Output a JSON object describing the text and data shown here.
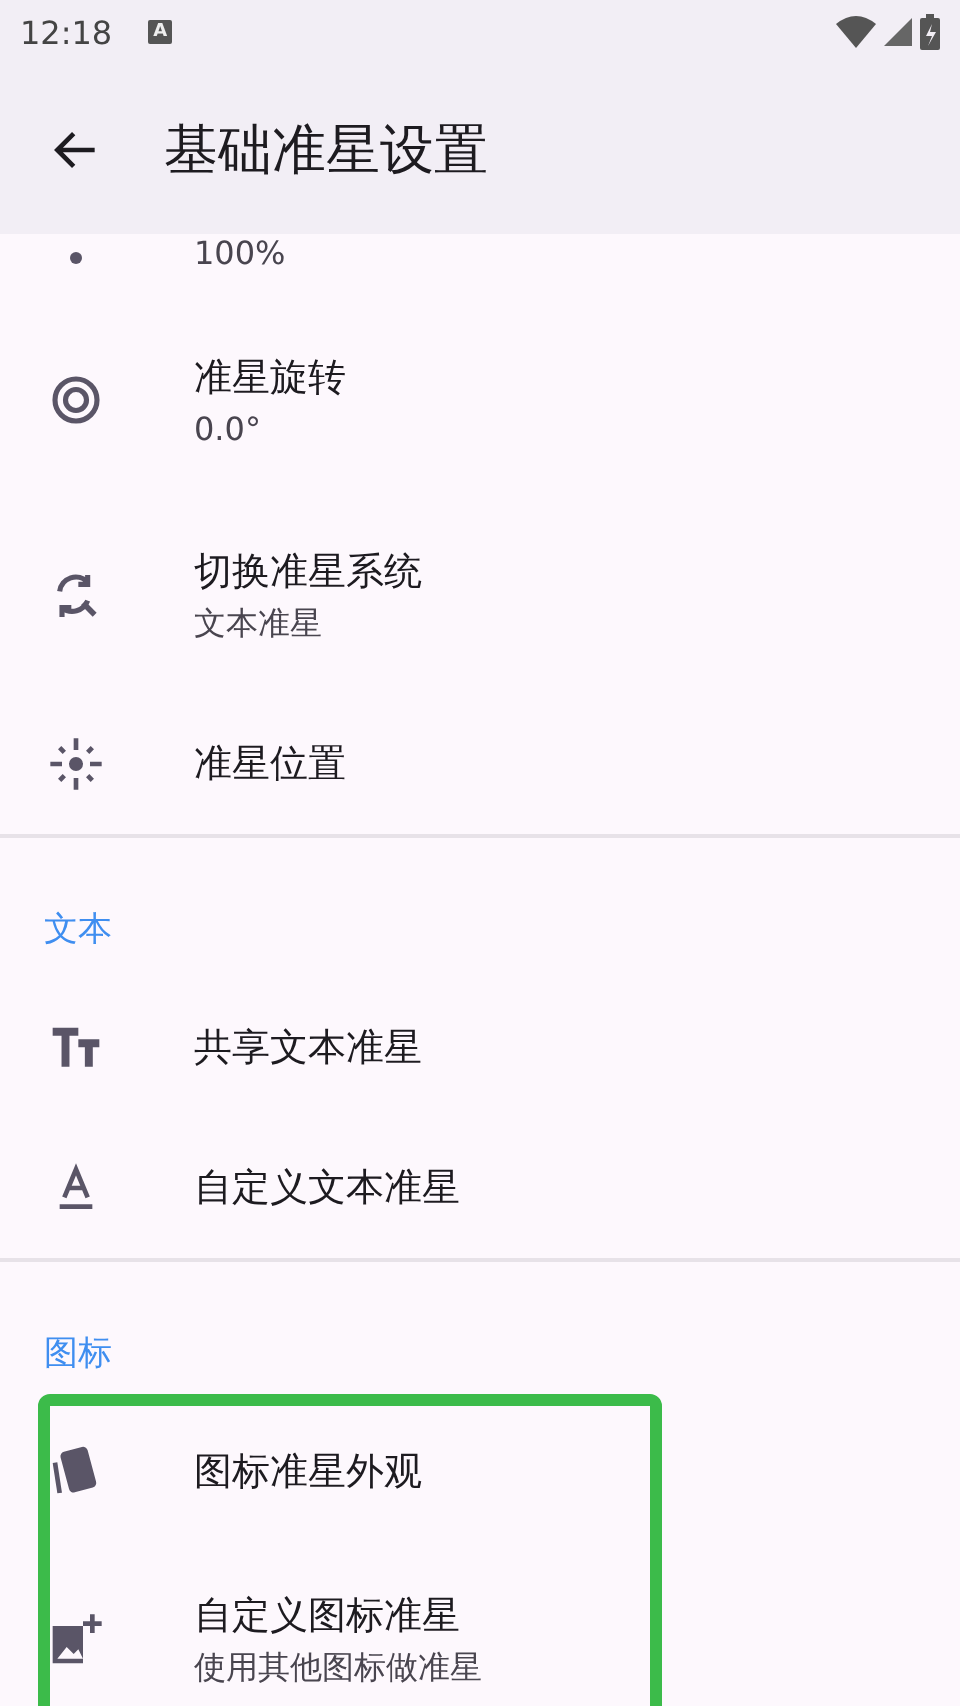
{
  "status_bar": {
    "time": "12:18",
    "notification": "A"
  },
  "app_bar": {
    "title": "基础准星设置"
  },
  "sections": [
    {
      "highlighted": false,
      "items": [
        {
          "summary": "100%",
          "kind": "cut"
        },
        {
          "title": "准星旋转",
          "summary": "0.0°",
          "kind": "double"
        },
        {
          "title": "切换准星系统",
          "summary": "文本准星",
          "kind": "double"
        },
        {
          "title": "准星位置",
          "kind": "single"
        }
      ]
    },
    {
      "header": "文本",
      "highlighted": false,
      "items": [
        {
          "title": "共享文本准星",
          "kind": "single"
        },
        {
          "title": "自定义文本准星",
          "kind": "single"
        }
      ]
    },
    {
      "header": "图标",
      "highlighted": true,
      "items": [
        {
          "title": "图标准星外观",
          "kind": "single"
        },
        {
          "title": "自定义图标准星",
          "summary": "使用其他图标做准星",
          "kind": "double"
        }
      ]
    }
  ]
}
